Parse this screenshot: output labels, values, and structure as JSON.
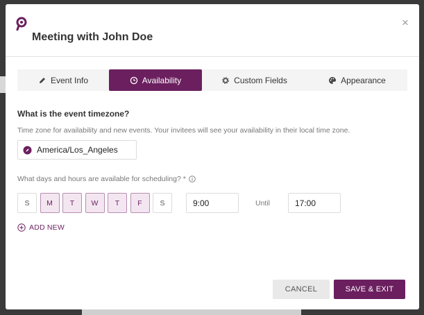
{
  "modal": {
    "title": "Meeting with John Doe",
    "close_icon": "close-icon",
    "brand_color": "#6b1f5f"
  },
  "tabs": [
    {
      "label": "Event Info",
      "icon": "pencil-icon",
      "active": false
    },
    {
      "label": "Availability",
      "icon": "clock-icon",
      "active": true
    },
    {
      "label": "Custom Fields",
      "icon": "gear-icon",
      "active": false
    },
    {
      "label": "Appearance",
      "icon": "palette-icon",
      "active": false
    }
  ],
  "timezone": {
    "question": "What is the event timezone?",
    "help": "Time zone for availability and new events. Your invitees will see your availability in their local time zone.",
    "value": "America/Los_Angeles"
  },
  "schedule": {
    "question": "What days and hours are available for scheduling? *",
    "days": [
      {
        "label": "S",
        "selected": false
      },
      {
        "label": "M",
        "selected": true
      },
      {
        "label": "T",
        "selected": true
      },
      {
        "label": "W",
        "selected": true
      },
      {
        "label": "T",
        "selected": true
      },
      {
        "label": "F",
        "selected": true
      },
      {
        "label": "S",
        "selected": false
      }
    ],
    "start": "9:00",
    "until_label": "Until",
    "end": "17:00",
    "add_new": "ADD NEW"
  },
  "footer": {
    "cancel": "CANCEL",
    "save": "SAVE & EXIT"
  }
}
